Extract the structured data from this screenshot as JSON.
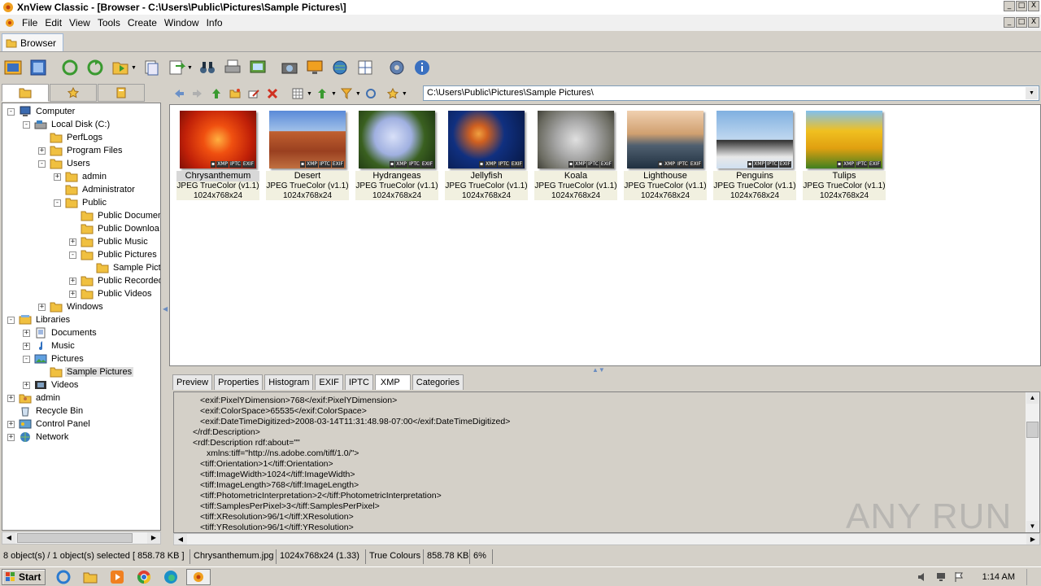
{
  "window": {
    "title": "XnView Classic - [Browser - C:\\Users\\Public\\Pictures\\Sample Pictures\\]",
    "controls": [
      "_",
      "□",
      "X"
    ]
  },
  "menu": [
    "File",
    "Edit",
    "View",
    "Tools",
    "Create",
    "Window",
    "Info"
  ],
  "tab": {
    "label": "Browser"
  },
  "address": {
    "path": "C:\\Users\\Public\\Pictures\\Sample Pictures\\"
  },
  "tree": [
    {
      "label": "Computer",
      "icon": "computer-icon"
    },
    {
      "label": "Local Disk (C:)",
      "icon": "drive-icon"
    },
    {
      "label": "PerfLogs",
      "icon": "folder-icon"
    },
    {
      "label": "Program Files",
      "icon": "folder-icon"
    },
    {
      "label": "Users",
      "icon": "folder-icon"
    },
    {
      "label": "admin",
      "icon": "folder-icon"
    },
    {
      "label": "Administrator",
      "icon": "folder-icon"
    },
    {
      "label": "Public",
      "icon": "folder-icon"
    },
    {
      "label": "Public Documen",
      "icon": "folder-icon"
    },
    {
      "label": "Public Downloa",
      "icon": "folder-icon"
    },
    {
      "label": "Public Music",
      "icon": "folder-icon"
    },
    {
      "label": "Public Pictures",
      "icon": "folder-icon"
    },
    {
      "label": "Sample Pictu",
      "icon": "folder-icon"
    },
    {
      "label": "Public Recorded",
      "icon": "folder-icon"
    },
    {
      "label": "Public Videos",
      "icon": "folder-icon"
    },
    {
      "label": "Windows",
      "icon": "folder-icon"
    },
    {
      "label": "Libraries",
      "icon": "library-icon"
    },
    {
      "label": "Documents",
      "icon": "documents-icon"
    },
    {
      "label": "Music",
      "icon": "music-icon"
    },
    {
      "label": "Pictures",
      "icon": "pictures-icon"
    },
    {
      "label": "Sample Pictures",
      "icon": "folder-icon"
    },
    {
      "label": "Videos",
      "icon": "videos-icon"
    },
    {
      "label": "admin",
      "icon": "user-folder-icon"
    },
    {
      "label": "Recycle Bin",
      "icon": "recycle-bin-icon"
    },
    {
      "label": "Control Panel",
      "icon": "control-panel-icon"
    },
    {
      "label": "Network",
      "icon": "network-icon"
    }
  ],
  "thumbnails": [
    {
      "name": "Chrysanthemum",
      "format": "JPEG TrueColor (v1.1)",
      "dims": "1024x768x24"
    },
    {
      "name": "Desert",
      "format": "JPEG TrueColor (v1.1)",
      "dims": "1024x768x24"
    },
    {
      "name": "Hydrangeas",
      "format": "JPEG TrueColor (v1.1)",
      "dims": "1024x768x24"
    },
    {
      "name": "Jellyfish",
      "format": "JPEG TrueColor (v1.1)",
      "dims": "1024x768x24"
    },
    {
      "name": "Koala",
      "format": "JPEG TrueColor (v1.1)",
      "dims": "1024x768x24"
    },
    {
      "name": "Lighthouse",
      "format": "JPEG TrueColor (v1.1)",
      "dims": "1024x768x24"
    },
    {
      "name": "Penguins",
      "format": "JPEG TrueColor (v1.1)",
      "dims": "1024x768x24"
    },
    {
      "name": "Tulips",
      "format": "JPEG TrueColor (v1.1)",
      "dims": "1024x768x24"
    }
  ],
  "badges": [
    "XMP",
    "IPTC",
    "EXIF"
  ],
  "info_tabs": [
    "Preview",
    "Properties",
    "Histogram",
    "EXIF",
    "IPTC",
    "XMP",
    "Categories"
  ],
  "xmp_lines": [
    "<exif:PixelYDimension>768</exif:PixelYDimension>",
    "<exif:ColorSpace>65535</exif:ColorSpace>",
    "<exif:DateTimeDigitized>2008-03-14T11:31:48.98-07:00</exif:DateTimeDigitized>",
    "</rdf:Description>",
    "<rdf:Description rdf:about=\"\"",
    "xmlns:tiff=\"http://ns.adobe.com/tiff/1.0/\">",
    "<tiff:Orientation>1</tiff:Orientation>",
    "<tiff:ImageWidth>1024</tiff:ImageWidth>",
    "<tiff:ImageLength>768</tiff:ImageLength>",
    "<tiff:PhotometricInterpretation>2</tiff:PhotometricInterpretation>",
    "<tiff:SamplesPerPixel>3</tiff:SamplesPerPixel>",
    "<tiff:XResolution>96/1</tiff:XResolution>",
    "<tiff:YResolution>96/1</tiff:YResolution>"
  ],
  "status": {
    "selection": "8 object(s) / 1 object(s) selected  [ 858.78 KB ]",
    "filename": "Chrysanthemum.jpg",
    "dimensions": "1024x768x24 (1.33)",
    "colors": "True Colours",
    "size": "858.78 KB",
    "zoom": "6%"
  },
  "taskbar": {
    "start": "Start",
    "clock": "1:14 AM"
  },
  "watermark": "ANY RUN"
}
